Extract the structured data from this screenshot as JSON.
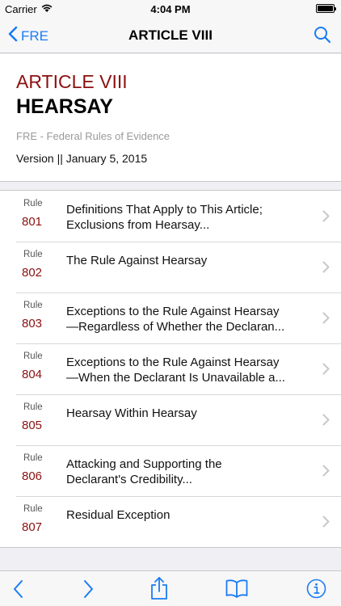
{
  "status_bar": {
    "carrier": "Carrier",
    "time": "4:04 PM"
  },
  "nav": {
    "back_label": "FRE",
    "title": "ARTICLE VIII",
    "accent_color": "#1a7cf5"
  },
  "article": {
    "number": "ARTICLE VIII",
    "name": "HEARSAY",
    "source": "FRE - Federal Rules of Evidence",
    "version": "Version || January 5, 2015"
  },
  "rules": [
    {
      "word": "Rule",
      "number": "801",
      "line1": "Definitions That Apply to This Article;",
      "line2": "Exclusions from Hearsay..."
    },
    {
      "word": "Rule",
      "number": "802",
      "line1": "The Rule Against Hearsay",
      "line2": ""
    },
    {
      "word": "Rule",
      "number": "803",
      "line1": "Exceptions to the Rule Against Hearsay",
      "line2": "—Regardless of Whether the Declaran..."
    },
    {
      "word": "Rule",
      "number": "804",
      "line1": "Exceptions to the Rule Against Hearsay",
      "line2": "—When the Declarant Is Unavailable a..."
    },
    {
      "word": "Rule",
      "number": "805",
      "line1": "Hearsay Within Hearsay",
      "line2": ""
    },
    {
      "word": "Rule",
      "number": "806",
      "line1": "Attacking and Supporting the",
      "line2": "Declarant's Credibility..."
    },
    {
      "word": "Rule",
      "number": "807",
      "line1": "Residual Exception",
      "line2": ""
    }
  ],
  "toolbar": {
    "icons": [
      "back-arrow-icon",
      "forward-arrow-icon",
      "share-icon",
      "book-icon",
      "info-icon"
    ]
  }
}
